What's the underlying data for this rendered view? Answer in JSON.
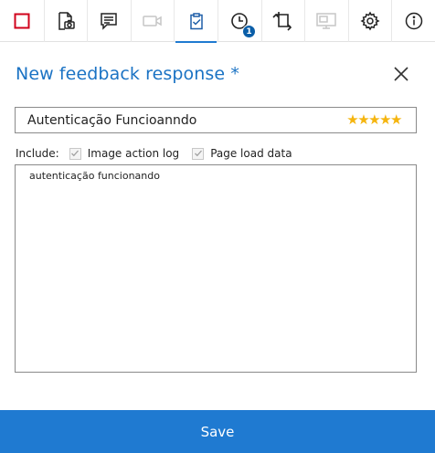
{
  "toolbar": {
    "items": [
      {
        "icon": "stop-record-icon",
        "state": "normal",
        "color": "#d0021b"
      },
      {
        "icon": "capture-screenshot-icon",
        "state": "normal"
      },
      {
        "icon": "comment-icon",
        "state": "normal"
      },
      {
        "icon": "video-camera-icon",
        "state": "disabled"
      },
      {
        "icon": "feedback-clipboard-icon",
        "state": "active"
      },
      {
        "icon": "history-clock-icon",
        "state": "normal",
        "badge": "1"
      },
      {
        "icon": "crop-rotate-icon",
        "state": "normal"
      },
      {
        "icon": "screen-icon",
        "state": "disabled"
      },
      {
        "icon": "settings-gear-icon",
        "state": "normal"
      },
      {
        "icon": "info-icon",
        "state": "normal"
      }
    ]
  },
  "panel": {
    "title": "New feedback response *",
    "feedback_title_value": "Autenticação Funcioanndo",
    "rating": 5,
    "rating_stars": [
      "★",
      "★",
      "★",
      "★",
      "★"
    ],
    "include_label": "Include:",
    "include_options": [
      {
        "label": "Image action log",
        "checked": true
      },
      {
        "label": "Page load data",
        "checked": true
      }
    ],
    "body_text": "autenticação funcionando"
  },
  "save_label": "Save",
  "colors": {
    "accent": "#1f7ad1",
    "title": "#1b73c4",
    "stars": "#f5b50f",
    "badge": "#0a5ea8",
    "record": "#d0021b"
  }
}
